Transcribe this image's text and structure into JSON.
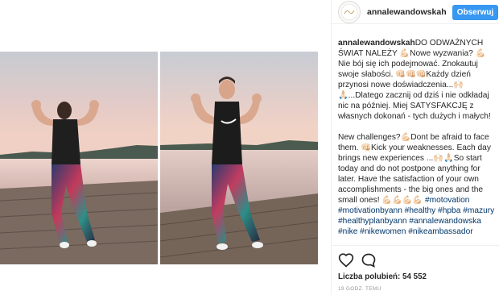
{
  "post": {
    "username": "annalewandowskah",
    "follow_label": "Obserwuj",
    "caption_pl": "DO ODWAŻNYCH ŚWIAT NALEŻY 💪🏻Nowe wyzwania? 💪🏻 Nie bój się ich podejmować. Znokautuj swoje słabości. 👊🏻👊🏻👊🏻Każdy dzień przynosi nowe doświadczenia...🙌🏻🙏🏻...Dlatego zacznij od dziś i nie odkładaj nic na później. Miej SATYSFAKCJĘ z własnych dokonań - tych dużych i małych!",
    "caption_en": "New challenges?💪🏻Dont be afraid to face them. 👊🏻Kick your weaknesses. Each day brings new experiences ...🙌🏻🙏🏻So start today and do not postpone anything for later. Have the satisfaction of your own accomplishments - the big ones and the small ones! 💪🏻💪🏻💪🏻💪🏻",
    "hashtags": "#motovation #motivationbyann #healthy #hpba #mazury #healthyplanbyann #annalewandowska #nike #nikewomen #nikeambassador",
    "likes_label": "Liczba polubień: 54 552",
    "time": "19 GODZ. TEMU"
  },
  "icons": {
    "like": "heart-outline-icon",
    "comment": "comment-bubble-icon"
  },
  "colors": {
    "follow": "#3897f0",
    "hashtag": "#003569",
    "meta": "#999999"
  }
}
